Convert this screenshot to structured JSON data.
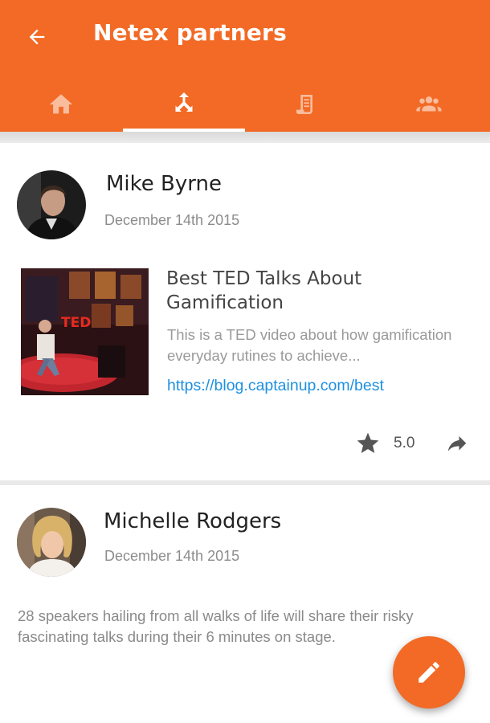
{
  "header": {
    "title": "Netex partners",
    "back_icon": "arrow-left-icon",
    "background": "#f26a25"
  },
  "tabs": [
    {
      "icon": "home-icon",
      "active": false
    },
    {
      "icon": "directions-split-icon",
      "active": true
    },
    {
      "icon": "document-icon",
      "active": false
    },
    {
      "icon": "group-icon",
      "active": false
    }
  ],
  "posts": [
    {
      "author": "Mike Byrne",
      "date": "December 14th 2015",
      "link": {
        "title": "Best TED Talks About Gamification",
        "description": "This is a TED video about how gamification everyday rutines to achieve...",
        "url": "https://blog.captainup.com/best",
        "thumb_label": "TED"
      },
      "rating": "5.0"
    },
    {
      "author": "Michelle Rodgers",
      "date": "December 14th 2015",
      "text": "28 speakers hailing from all walks of life will share their risky fascinating talks during their 6 minutes on stage."
    }
  ],
  "fab": {
    "icon": "pencil-icon"
  },
  "colors": {
    "accent": "#f26a25",
    "link": "#1e90e0"
  }
}
